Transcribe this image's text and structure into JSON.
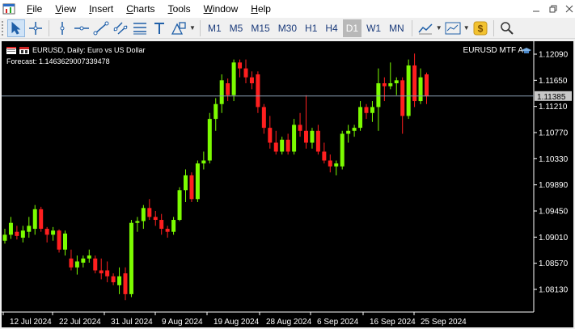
{
  "menu": {
    "items": [
      "File",
      "View",
      "Insert",
      "Charts",
      "Tools",
      "Window",
      "Help"
    ]
  },
  "window_controls": {
    "minimize": "minimize-icon",
    "restore": "restore-icon",
    "close": "close-icon"
  },
  "toolbar": {
    "tools": [
      "cursor",
      "crosshair",
      "vertical-line",
      "horizontal-line",
      "trendline",
      "channel",
      "fibonacci",
      "text",
      "shapes"
    ],
    "timeframes": [
      "M1",
      "M5",
      "M15",
      "M30",
      "H1",
      "H4",
      "D1",
      "W1",
      "MN"
    ],
    "active_timeframe": "D1"
  },
  "chart": {
    "title": "EURUSD, Daily:  Euro vs US Dollar",
    "forecast": "Forecast: 1.1463629007339478",
    "indicator": "EURUSD MTF A",
    "current_price": "1.11385",
    "colors": {
      "bull": "#7cfc00",
      "bear": "#ff1f1f",
      "background": "#000000",
      "axis": "#ffffff",
      "price_line": "#8ca0b4"
    }
  },
  "chart_data": {
    "type": "candlestick",
    "symbol": "EURUSD",
    "timeframe": "D1",
    "y_ticks": [
      "1.12090",
      "1.11650",
      "1.11210",
      "1.10770",
      "1.10330",
      "1.09890",
      "1.09450",
      "1.09010",
      "1.08570",
      "1.08130"
    ],
    "x_ticks": [
      "12 Jul 2024",
      "22 Jul 2024",
      "31 Jul 2024",
      "9 Aug 2024",
      "19 Aug 2024",
      "28 Aug 2024",
      "6 Sep 2024",
      "16 Sep 2024",
      "25 Sep 2024"
    ],
    "candles": [
      {
        "o": 1.0895,
        "h": 1.0915,
        "l": 1.089,
        "c": 1.0905
      },
      {
        "o": 1.0905,
        "h": 1.0935,
        "l": 1.0898,
        "c": 1.0925
      },
      {
        "o": 1.091,
        "h": 1.092,
        "l": 1.0897,
        "c": 1.0903
      },
      {
        "o": 1.09,
        "h": 1.092,
        "l": 1.0892,
        "c": 1.0912
      },
      {
        "o": 1.091,
        "h": 1.0935,
        "l": 1.09,
        "c": 1.092
      },
      {
        "o": 1.0915,
        "h": 1.0955,
        "l": 1.0905,
        "c": 1.0948
      },
      {
        "o": 1.0948,
        "h": 1.0952,
        "l": 1.091,
        "c": 1.0915
      },
      {
        "o": 1.0915,
        "h": 1.0918,
        "l": 1.0892,
        "c": 1.0905
      },
      {
        "o": 1.0905,
        "h": 1.0918,
        "l": 1.0895,
        "c": 1.0912
      },
      {
        "o": 1.0912,
        "h": 1.0914,
        "l": 1.0875,
        "c": 1.088
      },
      {
        "o": 1.088,
        "h": 1.0912,
        "l": 1.087,
        "c": 1.0907
      },
      {
        "o": 1.0865,
        "h": 1.088,
        "l": 1.0845,
        "c": 1.085
      },
      {
        "o": 1.085,
        "h": 1.087,
        "l": 1.0838,
        "c": 1.086
      },
      {
        "o": 1.0858,
        "h": 1.087,
        "l": 1.085,
        "c": 1.0865
      },
      {
        "o": 1.0865,
        "h": 1.088,
        "l": 1.0858,
        "c": 1.087
      },
      {
        "o": 1.0865,
        "h": 1.087,
        "l": 1.084,
        "c": 1.0845
      },
      {
        "o": 1.0845,
        "h": 1.0865,
        "l": 1.083,
        "c": 1.084
      },
      {
        "o": 1.0845,
        "h": 1.086,
        "l": 1.0825,
        "c": 1.0835
      },
      {
        "o": 1.0835,
        "h": 1.084,
        "l": 1.082,
        "c": 1.0825
      },
      {
        "o": 1.082,
        "h": 1.085,
        "l": 1.0805,
        "c": 1.0835
      },
      {
        "o": 1.084,
        "h": 1.085,
        "l": 1.0795,
        "c": 1.0805
      },
      {
        "o": 1.0805,
        "h": 1.093,
        "l": 1.08,
        "c": 1.0925
      },
      {
        "o": 1.0925,
        "h": 1.0935,
        "l": 1.091,
        "c": 1.0928
      },
      {
        "o": 1.0928,
        "h": 1.0955,
        "l": 1.0915,
        "c": 1.095
      },
      {
        "o": 1.095,
        "h": 1.0965,
        "l": 1.093,
        "c": 1.0935
      },
      {
        "o": 1.0935,
        "h": 1.0945,
        "l": 1.092,
        "c": 1.093
      },
      {
        "o": 1.093,
        "h": 1.094,
        "l": 1.0905,
        "c": 1.0915
      },
      {
        "o": 1.0915,
        "h": 1.092,
        "l": 1.09,
        "c": 1.091
      },
      {
        "o": 1.091,
        "h": 1.0935,
        "l": 1.0905,
        "c": 1.093
      },
      {
        "o": 1.093,
        "h": 1.0985,
        "l": 1.0928,
        "c": 1.098
      },
      {
        "o": 1.098,
        "h": 1.1015,
        "l": 1.096,
        "c": 1.1005
      },
      {
        "o": 1.1005,
        "h": 1.101,
        "l": 1.096,
        "c": 1.0965
      },
      {
        "o": 1.0965,
        "h": 1.103,
        "l": 1.096,
        "c": 1.1025
      },
      {
        "o": 1.1025,
        "h": 1.1045,
        "l": 1.1015,
        "c": 1.103
      },
      {
        "o": 1.103,
        "h": 1.111,
        "l": 1.1025,
        "c": 1.11
      },
      {
        "o": 1.11,
        "h": 1.1135,
        "l": 1.108,
        "c": 1.1125
      },
      {
        "o": 1.1125,
        "h": 1.1175,
        "l": 1.111,
        "c": 1.1165
      },
      {
        "o": 1.116,
        "h": 1.1168,
        "l": 1.113,
        "c": 1.114
      },
      {
        "o": 1.114,
        "h": 1.12,
        "l": 1.113,
        "c": 1.1195
      },
      {
        "o": 1.1195,
        "h": 1.12,
        "l": 1.117,
        "c": 1.1185
      },
      {
        "o": 1.1185,
        "h": 1.12,
        "l": 1.116,
        "c": 1.117
      },
      {
        "o": 1.117,
        "h": 1.118,
        "l": 1.115,
        "c": 1.116
      },
      {
        "o": 1.1175,
        "h": 1.118,
        "l": 1.111,
        "c": 1.112
      },
      {
        "o": 1.112,
        "h": 1.1125,
        "l": 1.1075,
        "c": 1.1085
      },
      {
        "o": 1.1085,
        "h": 1.1105,
        "l": 1.105,
        "c": 1.106
      },
      {
        "o": 1.106,
        "h": 1.108,
        "l": 1.104,
        "c": 1.1045
      },
      {
        "o": 1.1045,
        "h": 1.107,
        "l": 1.104,
        "c": 1.1065
      },
      {
        "o": 1.1065,
        "h": 1.1075,
        "l": 1.104,
        "c": 1.1045
      },
      {
        "o": 1.1045,
        "h": 1.11,
        "l": 1.104,
        "c": 1.109
      },
      {
        "o": 1.109,
        "h": 1.111,
        "l": 1.107,
        "c": 1.108
      },
      {
        "o": 1.108,
        "h": 1.114,
        "l": 1.105,
        "c": 1.106
      },
      {
        "o": 1.106,
        "h": 1.1085,
        "l": 1.105,
        "c": 1.108
      },
      {
        "o": 1.108,
        "h": 1.109,
        "l": 1.104,
        "c": 1.1045
      },
      {
        "o": 1.1045,
        "h": 1.106,
        "l": 1.1025,
        "c": 1.103
      },
      {
        "o": 1.103,
        "h": 1.104,
        "l": 1.101,
        "c": 1.102
      },
      {
        "o": 1.102,
        "h": 1.103,
        "l": 1.1005,
        "c": 1.1025
      },
      {
        "o": 1.102,
        "h": 1.108,
        "l": 1.1015,
        "c": 1.1075
      },
      {
        "o": 1.1075,
        "h": 1.109,
        "l": 1.106,
        "c": 1.108
      },
      {
        "o": 1.108,
        "h": 1.109,
        "l": 1.107,
        "c": 1.1085
      },
      {
        "o": 1.1085,
        "h": 1.113,
        "l": 1.108,
        "c": 1.112
      },
      {
        "o": 1.112,
        "h": 1.1125,
        "l": 1.11,
        "c": 1.111
      },
      {
        "o": 1.111,
        "h": 1.113,
        "l": 1.1095,
        "c": 1.112
      },
      {
        "o": 1.112,
        "h": 1.1185,
        "l": 1.108,
        "c": 1.116
      },
      {
        "o": 1.116,
        "h": 1.117,
        "l": 1.113,
        "c": 1.1155
      },
      {
        "o": 1.1155,
        "h": 1.1195,
        "l": 1.115,
        "c": 1.116
      },
      {
        "o": 1.116,
        "h": 1.117,
        "l": 1.114,
        "c": 1.1165
      },
      {
        "o": 1.1165,
        "h": 1.117,
        "l": 1.1075,
        "c": 1.1105
      },
      {
        "o": 1.1105,
        "h": 1.12,
        "l": 1.11,
        "c": 1.119
      },
      {
        "o": 1.119,
        "h": 1.121,
        "l": 1.112,
        "c": 1.113
      },
      {
        "o": 1.113,
        "h": 1.1185,
        "l": 1.1125,
        "c": 1.117
      },
      {
        "o": 1.1175,
        "h": 1.1178,
        "l": 1.1125,
        "c": 1.1138
      }
    ]
  }
}
